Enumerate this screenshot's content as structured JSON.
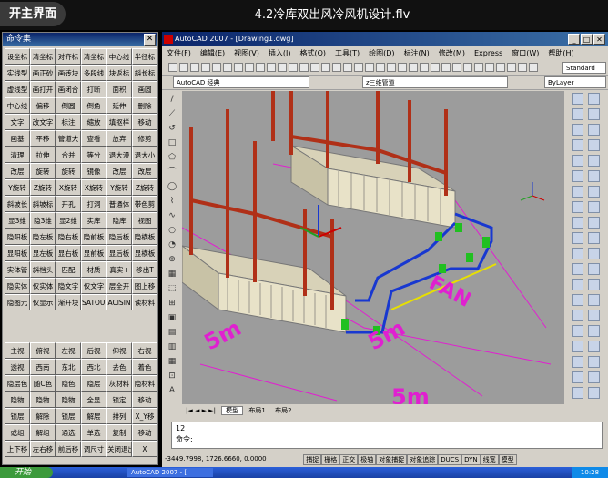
{
  "video": {
    "home_label": "开主界面",
    "title": "4.2冷库双出风冷风机设计.flv"
  },
  "palette": {
    "title": "命令集",
    "close": "✕",
    "rows_top": [
      [
        "设坐标",
        "清坐标",
        "对齐标",
        "清坐标",
        "中心线",
        "半径标"
      ],
      [
        "实线型",
        "画正砂",
        "画砖块",
        "多段线",
        "块返标",
        "斜长标"
      ],
      [
        "虚线型",
        "画打开",
        "画闭合",
        "打断",
        "面积",
        "画圆"
      ],
      [
        "中心线",
        "偏移",
        "倒圆",
        "倒角",
        "延伸",
        "删除"
      ],
      [
        "文字",
        "改文字",
        "标注",
        "缩放",
        "填抠样",
        "移动"
      ],
      [
        "画基",
        "平移",
        "管道大",
        "查看",
        "放弃",
        "修剪"
      ],
      [
        "清理",
        "拉伸",
        "合并",
        "等分",
        "退大漫",
        "退大小"
      ],
      [
        "改层",
        "旋转",
        "旋转",
        "镜像",
        "改层",
        "改层"
      ],
      [
        "Y旋转",
        "Z旋转",
        "X旋转",
        "X旋转",
        "Y旋转",
        "Z旋转"
      ],
      [
        "斜坡长",
        "斜坡标",
        "开孔",
        "打洞",
        "普通体",
        "带色剪"
      ],
      [
        "显3维",
        "隐3维",
        "显2维",
        "实库",
        "隐库",
        "视图"
      ],
      [
        "隐阳板",
        "隐左板",
        "隐右板",
        "隐前板",
        "隐后板",
        "隐横板"
      ],
      [
        "显阳板",
        "显左板",
        "显右板",
        "显前板",
        "显后板",
        "显横板"
      ],
      [
        "实体管",
        "斜档头",
        "匹配",
        "材质",
        "真实+",
        "移出T"
      ],
      [
        "隐实体",
        "仅实体",
        "隐文字",
        "仅文字",
        "层全开",
        "图上移"
      ],
      [
        "隐图元",
        "仅显示",
        "渐开块",
        "SATOUT",
        "ACISIN",
        "读材料"
      ]
    ],
    "rows_bottom": [
      [
        "主视",
        "俯视",
        "左视",
        "后视",
        "仰视",
        "右视"
      ],
      [
        "透视",
        "西南",
        "东北",
        "西北",
        "去色",
        "着色"
      ],
      [
        "隐层色",
        "随C色",
        "隐色",
        "隐层",
        "灰材料",
        "隐材料"
      ],
      [
        "隐物",
        "隐物",
        "隐物",
        "全显",
        "锁定",
        "移动"
      ],
      [
        "锁层",
        "解除",
        "锁层",
        "解层",
        "排列",
        "X_Y移"
      ],
      [
        "或组",
        "解组",
        "通选",
        "单选",
        "复制",
        "移动"
      ],
      [
        "上下移",
        "左右移",
        "前后移",
        "调尺寸",
        "关闭退出",
        "X"
      ]
    ]
  },
  "cad": {
    "title": "AutoCAD 2007 - [Drawing1.dwg]",
    "menus": [
      "文件(F)",
      "编辑(E)",
      "视图(V)",
      "插入(I)",
      "格式(O)",
      "工具(T)",
      "绘图(D)",
      "标注(N)",
      "修改(M)",
      "Express",
      "窗口(W)",
      "帮助(H)"
    ],
    "workspace": "AutoCAD 经典",
    "layer": "z三维管道",
    "color": "ByLayer",
    "style": "Standard",
    "labels": {
      "5m_left": "5m",
      "5m_right": "5m",
      "5m_bottom": "5m",
      "fan": "FAN"
    },
    "tabs": [
      "模型",
      "布局1",
      "布局2"
    ],
    "command_line1": "12",
    "command_line2": "命令:",
    "coords": "-3449.7998, 1726.6660, 0.0000",
    "status_buttons": [
      "捕捉",
      "栅格",
      "正交",
      "极轴",
      "对象捕捉",
      "对象追踪",
      "DUCS",
      "DYN",
      "线宽",
      "模型"
    ]
  },
  "taskbar": {
    "start": "开始",
    "task": "AutoCAD 2007 - [",
    "clock": "10:28"
  }
}
